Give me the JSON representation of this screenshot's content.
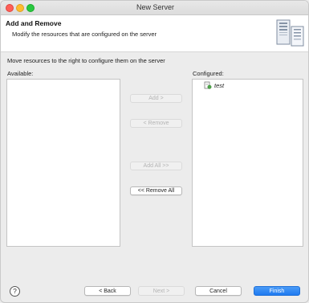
{
  "window": {
    "title": "New Server"
  },
  "banner": {
    "title": "Add and Remove",
    "description": "Modify the resources that are configured on the server",
    "graphic_icon": "server-graphic-icon"
  },
  "main": {
    "instruction": "Move resources to the right to configure them on the server",
    "available_label": "Available:",
    "configured_label": "Configured:",
    "available_items": [],
    "configured_items": [
      {
        "label": "test",
        "icon": "project-icon"
      }
    ]
  },
  "actions": {
    "add": "Add >",
    "remove": "< Remove",
    "add_all": "Add All >>",
    "remove_all": "<< Remove All"
  },
  "footer": {
    "help": "?",
    "back": "< Back",
    "next": "Next >",
    "cancel": "Cancel",
    "finish": "Finish"
  },
  "colors": {
    "accent": "#1f7af0",
    "close": "#fe5f57",
    "minimize": "#febc2e",
    "maximize": "#28c840"
  }
}
